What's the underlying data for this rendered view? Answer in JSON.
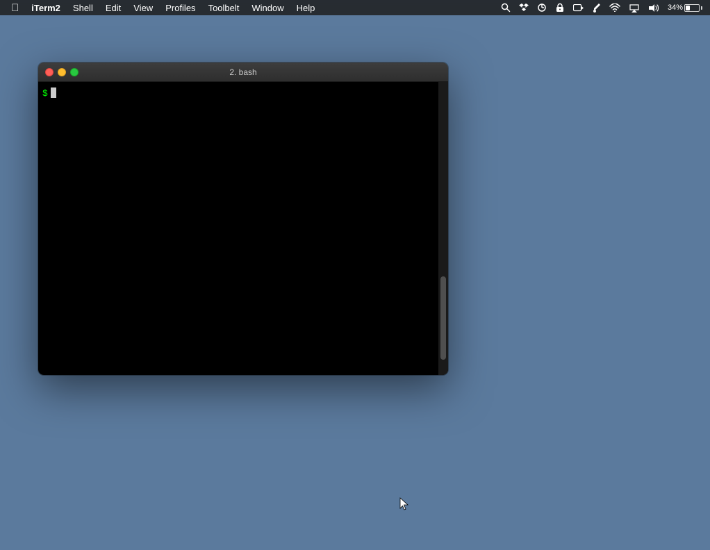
{
  "menubar": {
    "apple_label": "",
    "app_name": "iTerm2",
    "menu_items": [
      "Shell",
      "Edit",
      "View",
      "Profiles",
      "Toolbelt",
      "Window",
      "Help"
    ],
    "status_right": {
      "battery_percent": "34%",
      "time": ""
    }
  },
  "terminal": {
    "title": "2. bash",
    "prompt_char": "$",
    "traffic_lights": {
      "close_label": "close",
      "minimize_label": "minimize",
      "maximize_label": "maximize"
    }
  },
  "desktop": {
    "background_color": "#5b7a9d"
  }
}
